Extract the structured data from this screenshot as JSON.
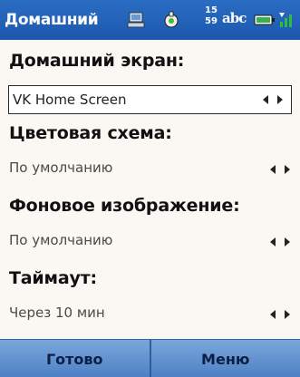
{
  "title": "Домашний",
  "status": {
    "clock_top": "15",
    "clock_bottom": "59",
    "input_mode": "abc"
  },
  "icons": [
    "network-icon",
    "volume-icon",
    "battery-icon",
    "signal-icon",
    "left-right-arrows-icon"
  ],
  "settings": {
    "home_screen": {
      "label": "Домашний экран:",
      "value": "VK Home Screen"
    },
    "color_scheme": {
      "label": "Цветовая схема:",
      "value": "По умолчанию"
    },
    "background_image": {
      "label": "Фоновое изображение:",
      "value": "По умолчанию"
    },
    "timeout": {
      "label": "Таймаут:",
      "value": "Через 10 мин"
    }
  },
  "softkeys": {
    "left": "Готово",
    "right": "Меню"
  },
  "colors": {
    "titlebar": "#1c58ad",
    "softbar": "#5f8fcc",
    "background": "#fbf7f3"
  }
}
